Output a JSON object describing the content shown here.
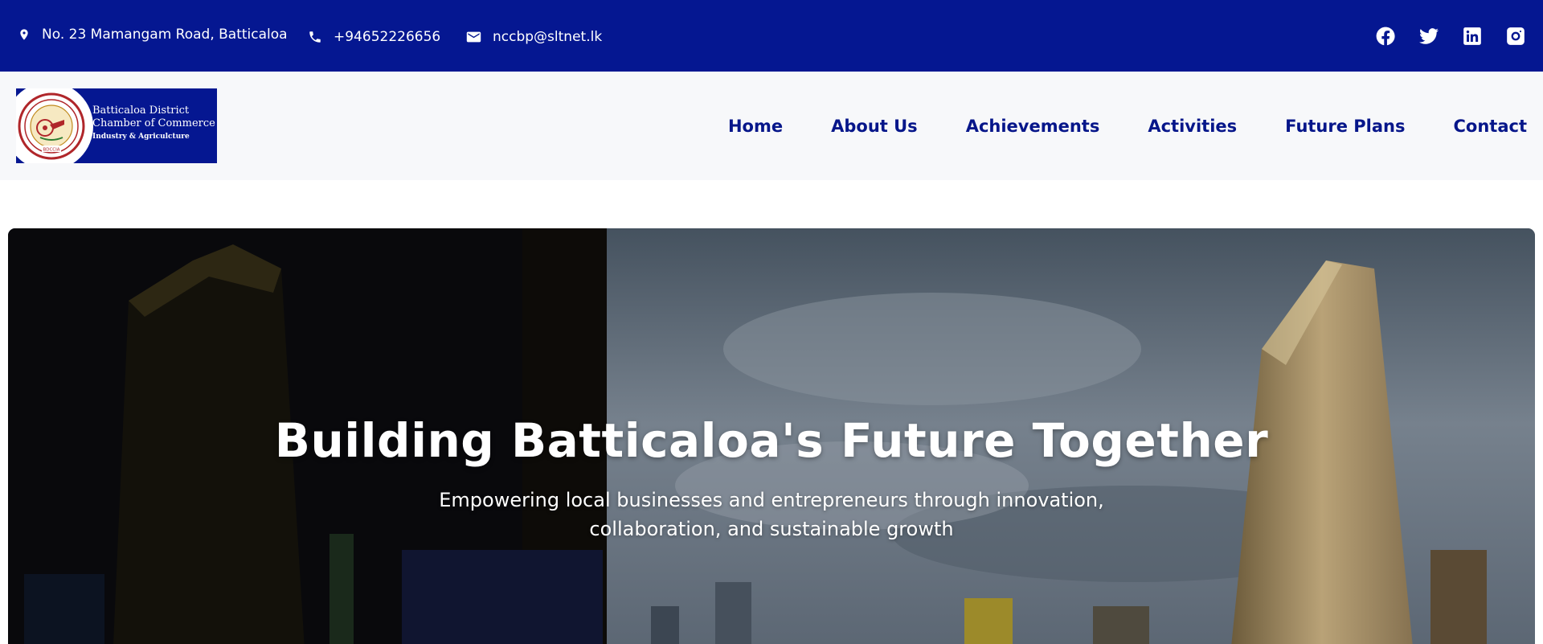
{
  "topbar": {
    "address": "No. 23 Mamangam Road, Batticaloa",
    "phone": "+94652226656",
    "email": "nccbp@sltnet.lk",
    "social_icons": [
      "facebook-icon",
      "twitter-icon",
      "linkedin-icon",
      "instagram-icon"
    ],
    "background_color": "#051791"
  },
  "logo": {
    "line1": "Batticaloa District",
    "line2": "Chamber of Commerce",
    "line3": "Industry & Agriculcture",
    "seal_text": "BDCCIA"
  },
  "nav": {
    "items": [
      {
        "label": "Home"
      },
      {
        "label": "About Us"
      },
      {
        "label": "Achievements"
      },
      {
        "label": "Activities"
      },
      {
        "label": "Future Plans"
      },
      {
        "label": "Contact"
      }
    ],
    "color": "#06168a"
  },
  "hero": {
    "title": "Building Batticaloa's Future Together",
    "subtitle": "Empowering local businesses and entrepreneurs through innovation, collaboration, and sustainable growth"
  }
}
